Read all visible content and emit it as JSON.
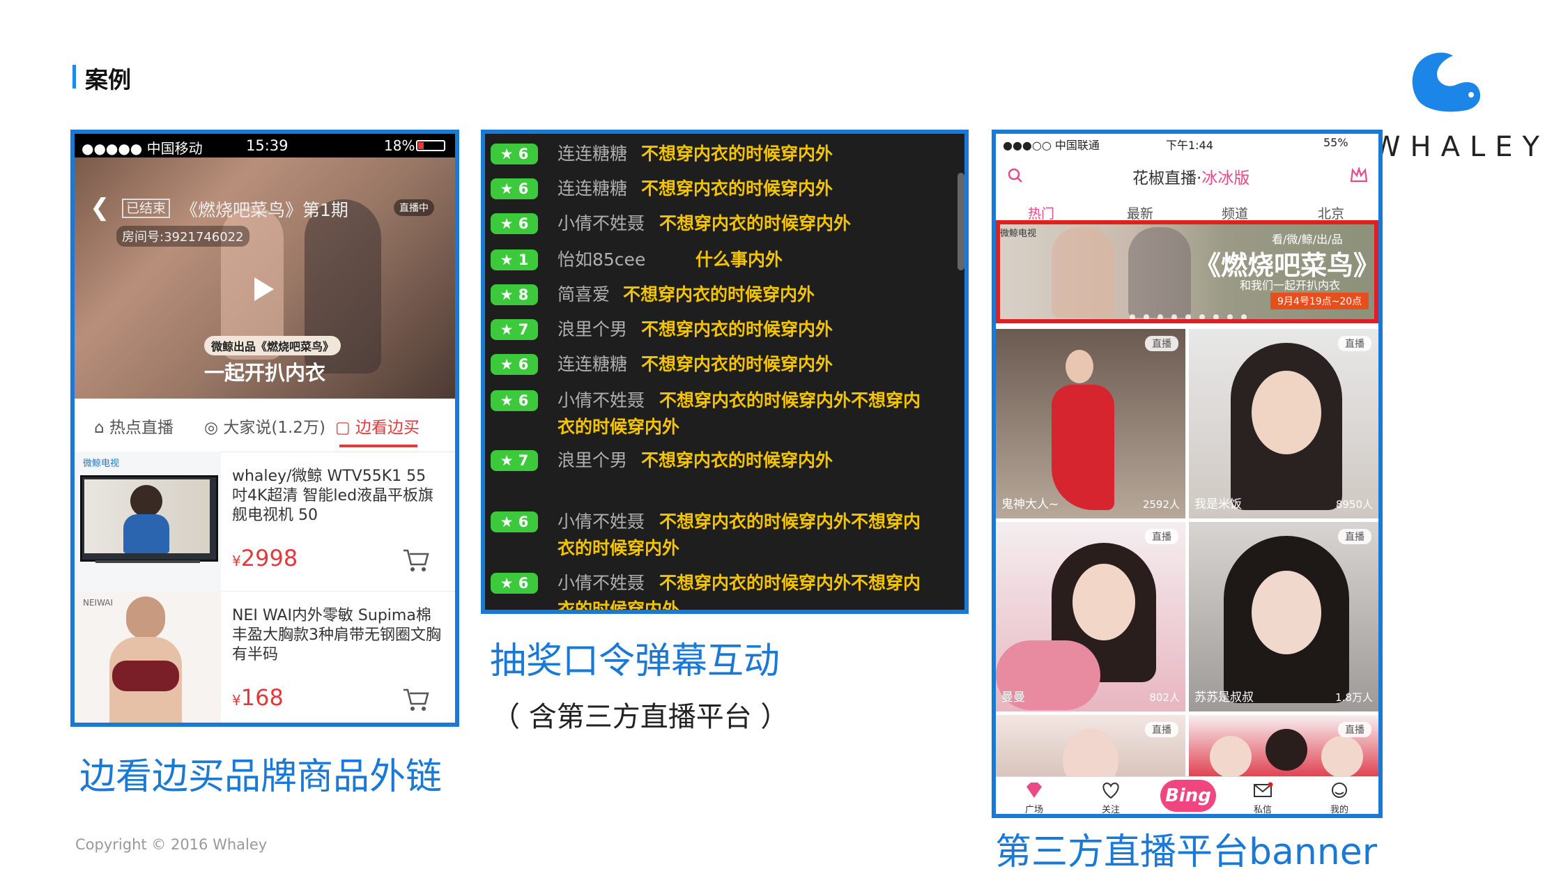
{
  "slide": {
    "title": "案例",
    "logo_text": "WHALEY",
    "copyright": "Copyright © 2016 Whaley"
  },
  "panel1": {
    "status": {
      "signal": "●●●●● 中国移动",
      "time": "15:39",
      "battery": "18%"
    },
    "video": {
      "ended_tag": "已结束",
      "title": "《燃烧吧菜鸟》第1期",
      "room": "房间号:3921746022",
      "live_badge": "直播中",
      "badge": "微鲸出品《燃烧吧菜鸟》",
      "slogan": "一起开扒内衣"
    },
    "tabs": [
      {
        "label": "热点直播"
      },
      {
        "label": "大家说(1.2万)"
      },
      {
        "label": "边看边买"
      }
    ],
    "products": [
      {
        "brand": "微鲸电视",
        "name": "whaley/微鲸 WTV55K1 55吋4K超清 智能led液晶平板旗舰电视机 50",
        "currency": "¥",
        "price": "2998"
      },
      {
        "brand": "NEIWAI",
        "name": "NEI WAI内外零敏 Supima棉丰盈大胸款3种肩带无钢圈文胸 有半码",
        "currency": "¥",
        "price": "168"
      }
    ],
    "caption": "边看边买品牌商品外链"
  },
  "panel2": {
    "rows": [
      {
        "level": "6",
        "user": "连连糖糖",
        "msg": "不想穿内衣的时候穿内外"
      },
      {
        "level": "6",
        "user": "连连糖糖",
        "msg": "不想穿内衣的时候穿内外"
      },
      {
        "level": "6",
        "user": "小倩不姓聂",
        "msg": "不想穿内衣的时候穿内外"
      },
      {
        "level": "1",
        "user": "怡如85cee",
        "msg": "什么事内外"
      },
      {
        "level": "8",
        "user": "简喜爱",
        "msg": "不想穿内衣的时候穿内外"
      },
      {
        "level": "7",
        "user": "浪里个男",
        "msg": "不想穿内衣的时候穿内外"
      },
      {
        "level": "6",
        "user": "连连糖糖",
        "msg": "不想穿内衣的时候穿内外"
      },
      {
        "level": "6",
        "user": "小倩不姓聂",
        "msg": "不想穿内衣的时候穿内外不想穿内",
        "cont": "衣的时候穿内外"
      },
      {
        "level": "7",
        "user": "浪里个男",
        "msg": "不想穿内衣的时候穿内外"
      },
      {
        "level": "6",
        "user": "小倩不姓聂",
        "msg": "不想穿内衣的时候穿内外不想穿内",
        "cont": "衣的时候穿内外"
      },
      {
        "level": "6",
        "user": "小倩不姓聂",
        "msg": "不想穿内衣的时候穿内外不想穿内",
        "cont": "衣的时候穿内外"
      }
    ],
    "caption": "抽奖口令弹幕互动",
    "subcaption": "（ 含第三方直播平台 ）"
  },
  "panel3": {
    "status": {
      "signal": "●●●○○ 中国联通",
      "time": "下午1:44",
      "battery": "55%"
    },
    "title_a": "花椒直播·",
    "title_b": "冰冰版",
    "tabs": [
      "热门",
      "最新",
      "频道",
      "北京"
    ],
    "banner": {
      "logo": "微鲸电视",
      "sub": "看/微/鲸/出/品",
      "title": "《燃烧吧菜鸟》",
      "sub2": "和我们一起开扒内衣",
      "date": "9月4号19点~20点"
    },
    "tiles": [
      {
        "name": "鬼神大人~",
        "count": "2592人",
        "live": "直播"
      },
      {
        "name": "我是米饭",
        "count": "8950人",
        "live": "直播"
      },
      {
        "name": "曼曼",
        "count": "802人",
        "live": "直播"
      },
      {
        "name": "苏苏是叔叔",
        "count": "1.8万人",
        "live": "直播"
      },
      {
        "name": "",
        "count": "",
        "live": "直播"
      },
      {
        "name": "",
        "count": "",
        "live": "直播"
      }
    ],
    "nav": [
      {
        "label": "广场"
      },
      {
        "label": "关注"
      },
      {
        "label": "Bing"
      },
      {
        "label": "私信"
      },
      {
        "label": "我的"
      }
    ],
    "caption": "第三方直播平台banner"
  },
  "colors": {
    "accent": "#1b79d6",
    "red": "#e4393c",
    "pink": "#e84a86",
    "danmu": "#f5c400",
    "level": "#3cc93c"
  }
}
